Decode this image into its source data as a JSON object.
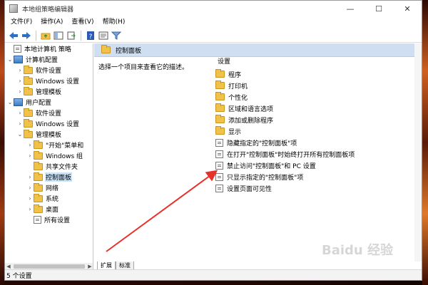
{
  "window": {
    "title": "本地组策略编辑器",
    "controls": {
      "minimize": "—",
      "maximize": "☐",
      "close": "✕"
    }
  },
  "menu": [
    "文件(F)",
    "操作(A)",
    "查看(V)",
    "帮助(H)"
  ],
  "toolbar": {
    "icons": [
      "back-icon",
      "forward-icon",
      "up-folder-icon",
      "show-hide-tree-icon",
      "export-list-icon",
      "help-icon",
      "properties-icon",
      "filter-icon"
    ]
  },
  "tree": {
    "items": [
      {
        "label": "本地计算机 策略",
        "expander": "",
        "icon": "policy"
      },
      {
        "label": "计算机配置",
        "expander": "⌄",
        "icon": "computer"
      },
      {
        "label": "软件设置",
        "expander": "›",
        "icon": "folder"
      },
      {
        "label": "Windows 设置",
        "expander": "›",
        "icon": "folder"
      },
      {
        "label": "管理模板",
        "expander": "›",
        "icon": "folder"
      },
      {
        "label": "用户配置",
        "expander": "⌄",
        "icon": "computer"
      },
      {
        "label": "软件设置",
        "expander": "›",
        "icon": "folder"
      },
      {
        "label": "Windows 设置",
        "expander": "›",
        "icon": "folder"
      },
      {
        "label": "管理模板",
        "expander": "⌄",
        "icon": "folder"
      },
      {
        "label": "\"开始\"菜单和",
        "expander": "›",
        "icon": "folder"
      },
      {
        "label": "Windows 组",
        "expander": "›",
        "icon": "folder"
      },
      {
        "label": "共享文件夹",
        "expander": "",
        "icon": "folder"
      },
      {
        "label": "控制面板",
        "expander": "›",
        "icon": "folder",
        "selected": true
      },
      {
        "label": "网络",
        "expander": "›",
        "icon": "folder"
      },
      {
        "label": "系统",
        "expander": "›",
        "icon": "folder"
      },
      {
        "label": "桌面",
        "expander": "›",
        "icon": "folder"
      },
      {
        "label": "所有设置",
        "expander": "",
        "icon": "policy"
      }
    ]
  },
  "right": {
    "header": "控制面板",
    "description": "选择一个项目来查看它的描述。",
    "column_header": "设置",
    "folders": [
      "程序",
      "打印机",
      "个性化",
      "区域和语言选项",
      "添加或删除程序",
      "显示"
    ],
    "settings": [
      "隐藏指定的\"控制面板\"项",
      "在打开\"控制面板\"时始终打开所有控制面板项",
      "禁止访问\"控制面板\"和 PC 设置",
      "只显示指定的\"控制面板\"项",
      "设置页面可见性"
    ]
  },
  "tabs": [
    "扩展",
    "标准"
  ],
  "status": "5 个设置",
  "annotation": {
    "color": "#e8302a"
  },
  "watermark": "Baidu 经验"
}
